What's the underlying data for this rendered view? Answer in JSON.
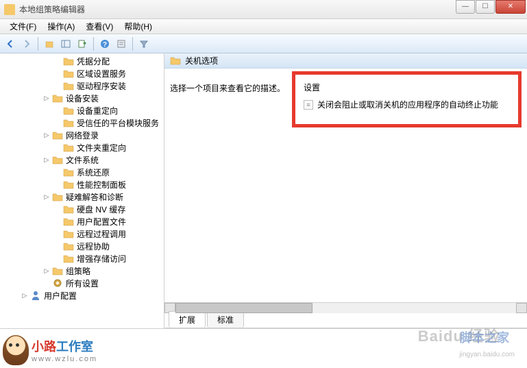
{
  "window": {
    "title": "本地组策略编辑器"
  },
  "menu": {
    "file": "文件(F)",
    "action": "操作(A)",
    "view": "查看(V)",
    "help": "帮助(H)"
  },
  "tree": {
    "items": [
      {
        "indent": "a",
        "exp": "",
        "label": "凭据分配"
      },
      {
        "indent": "a",
        "exp": "",
        "label": "区域设置服务"
      },
      {
        "indent": "a",
        "exp": "",
        "label": "驱动程序安装"
      },
      {
        "indent": "b",
        "exp": "▷",
        "label": "设备安装"
      },
      {
        "indent": "a",
        "exp": "",
        "label": "设备重定向"
      },
      {
        "indent": "a",
        "exp": "",
        "label": "受信任的平台模块服务"
      },
      {
        "indent": "b",
        "exp": "▷",
        "label": "网络登录"
      },
      {
        "indent": "a",
        "exp": "",
        "label": "文件夹重定向"
      },
      {
        "indent": "b",
        "exp": "▷",
        "label": "文件系统"
      },
      {
        "indent": "a",
        "exp": "",
        "label": "系统还原"
      },
      {
        "indent": "a",
        "exp": "",
        "label": "性能控制面板"
      },
      {
        "indent": "b",
        "exp": "▷",
        "label": "疑难解答和诊断"
      },
      {
        "indent": "a",
        "exp": "",
        "label": "硬盘 NV 缓存"
      },
      {
        "indent": "a",
        "exp": "",
        "label": "用户配置文件"
      },
      {
        "indent": "a",
        "exp": "",
        "label": "远程过程调用"
      },
      {
        "indent": "a",
        "exp": "",
        "label": "远程协助"
      },
      {
        "indent": "a",
        "exp": "",
        "label": "增强存储访问"
      },
      {
        "indent": "b",
        "exp": "▷",
        "label": "组策略"
      }
    ],
    "all_settings": "所有设置",
    "user_config": "用户配置"
  },
  "detail": {
    "header": "关机选项",
    "select_hint": "选择一个项目来查看它的描述。",
    "setting_header": "设置",
    "setting_item": "关闭会阻止或取消关机的应用程序的自动终止功能"
  },
  "tabs": {
    "extended": "扩展",
    "standard": "标准"
  },
  "logo": {
    "cn_red": "小路",
    "cn_blue": "工作室",
    "url": "www.wzlu.com"
  },
  "watermark": {
    "baidu": "Baidu 经验",
    "jyb": "jingyan.baidu.com",
    "jbzj": "脚本之家"
  }
}
